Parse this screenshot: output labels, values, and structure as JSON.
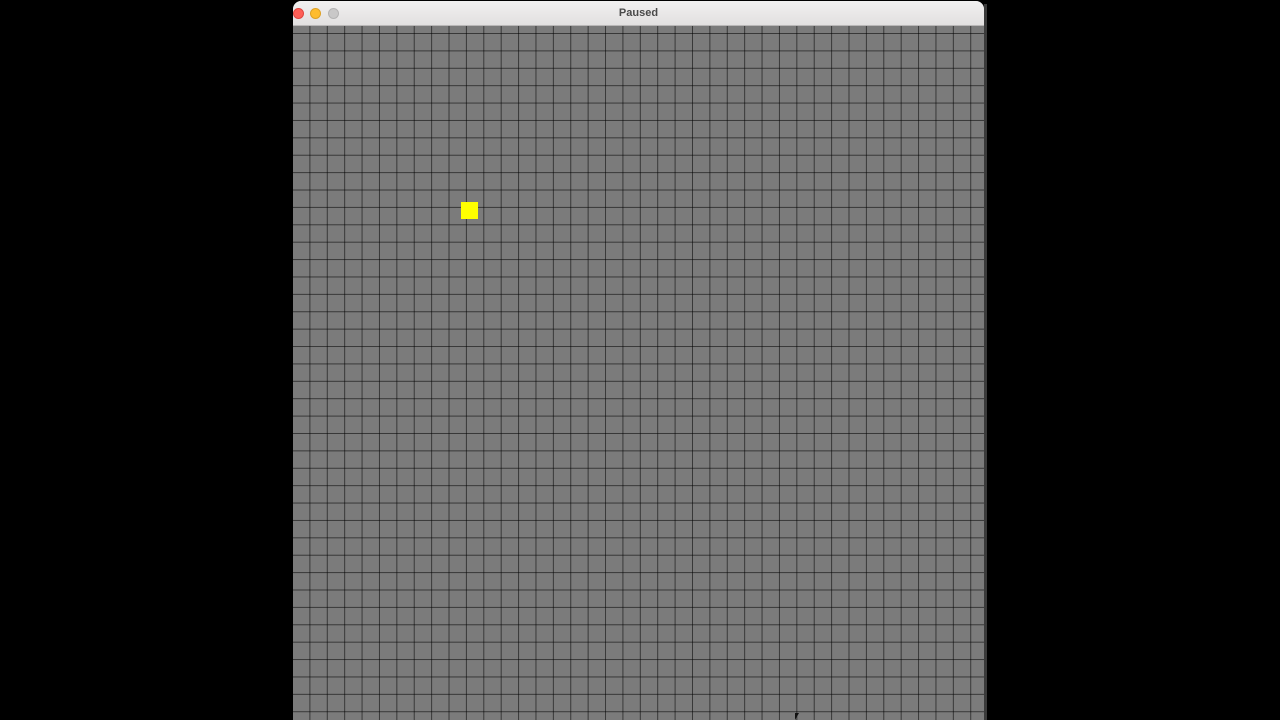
{
  "window": {
    "title": "Paused"
  },
  "game": {
    "state": "Paused",
    "colors": {
      "board": "#7b7b7b",
      "grid_line": "#2a2a2a",
      "live_cell": "#ffff00"
    },
    "live_cell_icon": "yellow-square"
  }
}
